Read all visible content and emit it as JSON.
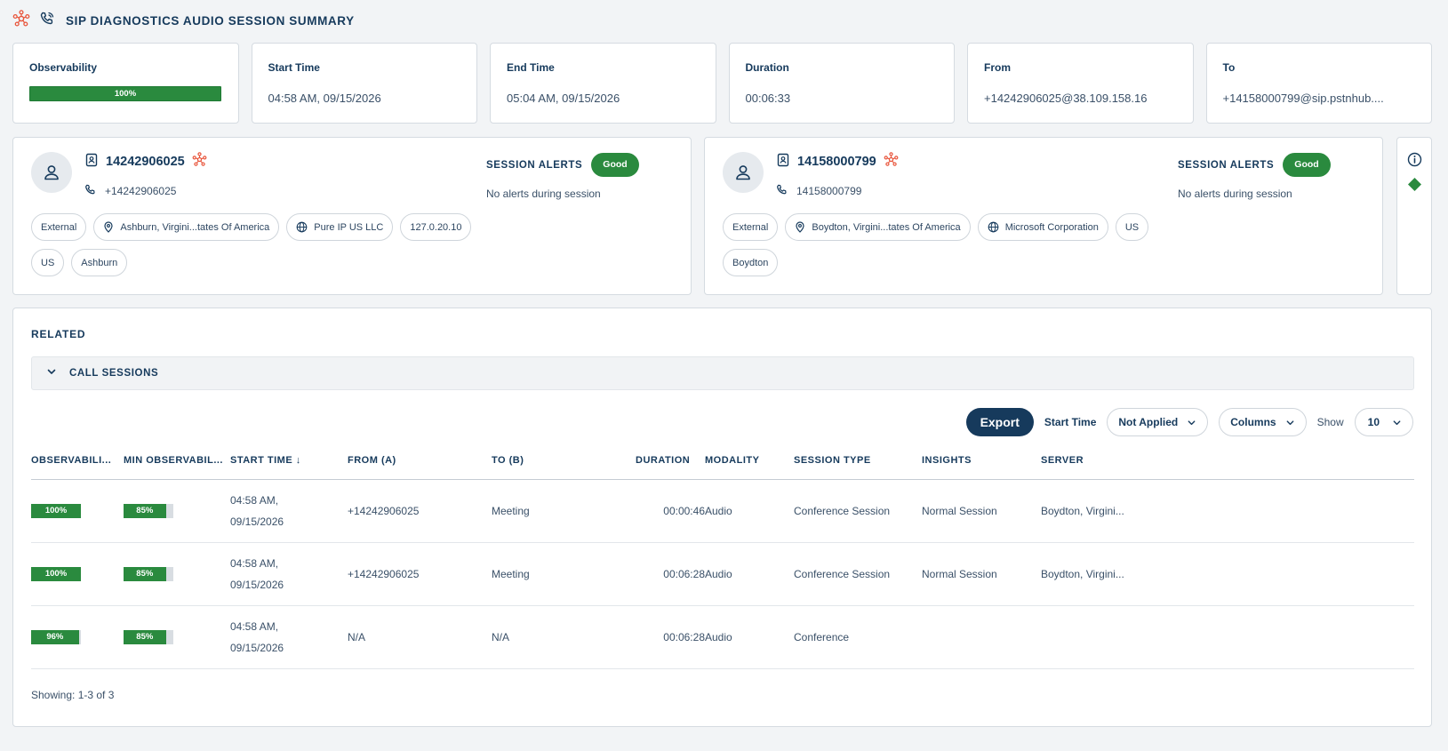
{
  "header": {
    "title": "SIP DIAGNOSTICS AUDIO SESSION SUMMARY",
    "icons": [
      "network-icon",
      "phone-icon"
    ]
  },
  "summary": {
    "observability": {
      "label": "Observability",
      "value_label": "100%",
      "value": 100
    },
    "start_time": {
      "label": "Start Time",
      "value": "04:58 AM, 09/15/2026"
    },
    "end_time": {
      "label": "End Time",
      "value": "05:04 AM, 09/15/2026"
    },
    "duration": {
      "label": "Duration",
      "value": "00:06:33"
    },
    "from": {
      "label": "From",
      "value": "+14242906025@38.109.158.16"
    },
    "to": {
      "label": "To",
      "value": "+14158000799@sip.pstnhub...."
    }
  },
  "participant_a": {
    "number": "14242906025",
    "phone": "+14242906025",
    "alerts_label": "SESSION ALERTS",
    "alerts_badge": "Good",
    "alerts_message": "No alerts during session",
    "chips": {
      "type": "External",
      "location": "Ashburn, Virgini...tates Of America",
      "isp": "Pure IP US LLC",
      "ip": "127.0.20.10",
      "country": "US",
      "city": "Ashburn"
    }
  },
  "participant_b": {
    "number": "14158000799",
    "phone": "14158000799",
    "alerts_label": "SESSION ALERTS",
    "alerts_badge": "Good",
    "alerts_message": "No alerts during session",
    "chips": {
      "type": "External",
      "location": "Boydton, Virgini...tates Of America",
      "isp": "Microsoft Corporation",
      "country": "US",
      "city": "Boydton"
    }
  },
  "related": {
    "title": "RELATED",
    "accordion_label": "CALL SESSIONS",
    "toolbar": {
      "export_label": "Export",
      "start_time_label": "Start Time",
      "start_time_value": "Not Applied",
      "columns_label": "Columns",
      "show_label": "Show",
      "show_value": "10"
    },
    "columns": {
      "observability": "OBSERVABILI...",
      "min_observability": "MIN OBSERVABIL...",
      "start_time": "START TIME ↓",
      "from": "FROM (A)",
      "to": "TO (B)",
      "duration": "DURATION",
      "modality": "MODALITY",
      "session_type": "SESSION TYPE",
      "insights": "INSIGHTS",
      "server": "SERVER"
    },
    "rows": [
      {
        "obs_label": "100%",
        "obs": 100,
        "min_label": "85%",
        "min": 85,
        "start_time": "04:58 AM,",
        "start_date": "09/15/2026",
        "from": "+14242906025",
        "to": "Meeting",
        "duration": "00:00:46",
        "modality": "Audio",
        "session_type": "Conference Session",
        "insights": "Normal Session",
        "server": "Boydton, Virgini..."
      },
      {
        "obs_label": "100%",
        "obs": 100,
        "min_label": "85%",
        "min": 85,
        "start_time": "04:58 AM,",
        "start_date": "09/15/2026",
        "from": "+14242906025",
        "to": "Meeting",
        "duration": "00:06:28",
        "modality": "Audio",
        "session_type": "Conference Session",
        "insights": "Normal Session",
        "server": "Boydton, Virgini..."
      },
      {
        "obs_label": "96%",
        "obs": 96,
        "min_label": "85%",
        "min": 85,
        "start_time": "04:58 AM,",
        "start_date": "09/15/2026",
        "from": "N/A",
        "to": "N/A",
        "duration": "00:06:28",
        "modality": "Audio",
        "session_type": "Conference",
        "insights": "",
        "server": ""
      }
    ],
    "showing": "Showing: 1-3 of 3"
  },
  "colors": {
    "navy": "#163a5c",
    "good_green": "#2a8a3e",
    "accent_orange": "#e8543a",
    "status_diamond": "#2a8a3e"
  }
}
